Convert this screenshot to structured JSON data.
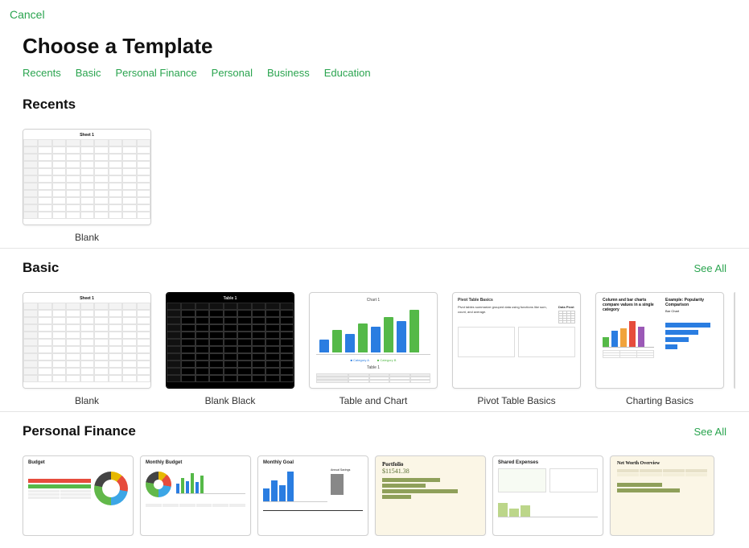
{
  "topbar": {
    "cancel": "Cancel"
  },
  "title": "Choose a Template",
  "tabs": [
    "Recents",
    "Basic",
    "Personal Finance",
    "Personal",
    "Business",
    "Education"
  ],
  "sections": {
    "recents": {
      "title": "Recents",
      "templates": [
        {
          "label": "Blank",
          "kind": "blank"
        }
      ]
    },
    "basic": {
      "title": "Basic",
      "see_all": "See All",
      "templates": [
        {
          "label": "Blank",
          "kind": "blank"
        },
        {
          "label": "Blank Black",
          "kind": "blank-black"
        },
        {
          "label": "Table and Chart",
          "kind": "table-chart"
        },
        {
          "label": "Pivot Table Basics",
          "kind": "pivot"
        },
        {
          "label": "Charting Basics",
          "kind": "charting"
        }
      ]
    },
    "personal_finance": {
      "title": "Personal Finance",
      "see_all": "See All",
      "templates": [
        {
          "label": "Budget",
          "kind": "budget"
        },
        {
          "label": "Monthly Budget",
          "kind": "monthly-budget"
        },
        {
          "label": "Monthly Goal",
          "kind": "monthly-goal"
        },
        {
          "label": "Portfolio",
          "kind": "portfolio"
        },
        {
          "label": "Shared Expenses",
          "kind": "shared-expenses"
        },
        {
          "label": "Net Worth Overview",
          "kind": "net-worth"
        }
      ]
    }
  },
  "thumbs": {
    "sheet_title": "Sheet 1",
    "table1": "Table 1",
    "chart1_title": "Chart 1",
    "tac_legend": [
      "Category A",
      "Category B"
    ],
    "pivot_title": "Pivot Table Basics",
    "pivot_right_hdr": "Data Pivot",
    "charting_left_title": "Column and bar charts compare values in a single category",
    "charting_right_title": "Example: Popularity Comparison",
    "bar_chart_title": "Bar Chart",
    "budget_title": "Budget",
    "monthly_budget_title": "Monthly Budget",
    "monthly_goal_title": "Monthly Goal",
    "monthly_goal_sub": "Annual Savings",
    "portfolio_title": "Portfolio",
    "portfolio_amount": "$11541.38",
    "shared_title": "Shared Expenses",
    "networth_title": "Net Worth Overview"
  }
}
